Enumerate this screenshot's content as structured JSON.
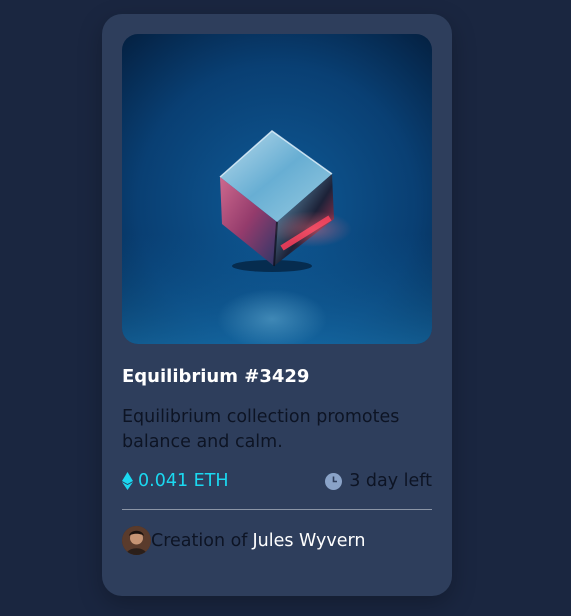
{
  "card": {
    "title": "Equilibrium #3429",
    "description": "Equilibrium collection promotes balance and calm.",
    "price": "0.041 ETH",
    "time_left": "3 day left",
    "creator_prefix": "Creation of",
    "creator_name": "Jules Wyvern"
  },
  "icons": {
    "price": "ethereum-icon",
    "time": "clock-icon",
    "avatar": "creator-avatar"
  },
  "colors": {
    "page_background": "#1a2640",
    "card_background": "#2e3e5c",
    "accent_cyan": "#1bd8f0",
    "title_white": "#ffffff",
    "body_dark": "#0d1424",
    "divider": "#8b95a6"
  }
}
